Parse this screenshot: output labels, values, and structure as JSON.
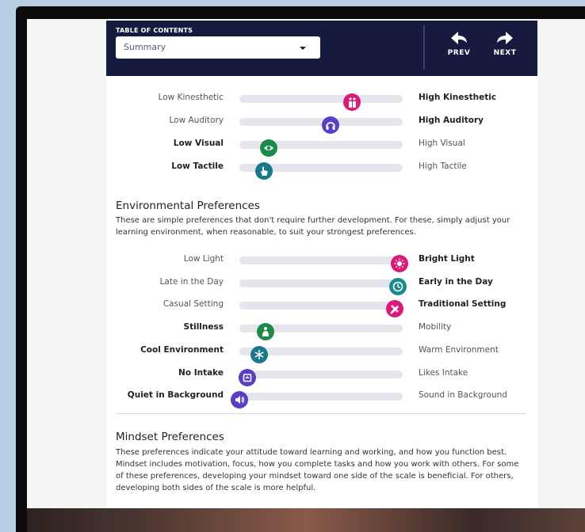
{
  "toc": {
    "label": "TABLE OF CONTENTS",
    "selected": "Summary"
  },
  "nav": {
    "prev_label": "PREV",
    "next_label": "NEXT"
  },
  "learning_rows": [
    {
      "left": "Low Kinesthetic",
      "right": "High Kinesthetic",
      "strong": "right",
      "value": 0.69,
      "icon": "kinesthetic-icon",
      "color": "#d81b78"
    },
    {
      "left": "Low Auditory",
      "right": "High Auditory",
      "strong": "right",
      "value": 0.56,
      "icon": "headphones-icon",
      "color": "#5a3fc4"
    },
    {
      "left": "Low Visual",
      "right": "High Visual",
      "strong": "left",
      "value": 0.18,
      "icon": "eye-icon",
      "color": "#1e8a4a"
    },
    {
      "left": "Low Tactile",
      "right": "High Tactile",
      "strong": "left",
      "value": 0.15,
      "icon": "hand-icon",
      "color": "#1a7a8a"
    }
  ],
  "environmental": {
    "title": "Environmental Preferences",
    "description": "These are simple preferences that don't require further development. For these, simply adjust your learning environment, when reasonable, to suit your strongest preferences.",
    "rows": [
      {
        "left": "Low Light",
        "right": "Bright Light",
        "strong": "right",
        "value": 0.98,
        "icon": "sun-icon",
        "color": "#d81b78"
      },
      {
        "left": "Late in the Day",
        "right": "Early in the Day",
        "strong": "right",
        "value": 0.97,
        "icon": "clock-icon",
        "color": "#1a8a8a"
      },
      {
        "left": "Casual Setting",
        "right": "Traditional Setting",
        "strong": "right",
        "value": 0.95,
        "icon": "pencil-ruler-icon",
        "color": "#d81b78"
      },
      {
        "left": "Stillness",
        "right": "Mobility",
        "strong": "left",
        "value": 0.16,
        "icon": "person-icon",
        "color": "#1e8a4a"
      },
      {
        "left": "Cool Environment",
        "right": "Warm Environment",
        "strong": "left",
        "value": 0.12,
        "icon": "snowflake-icon",
        "color": "#1a7a8a"
      },
      {
        "left": "No Intake",
        "right": "Likes Intake",
        "strong": "left",
        "value": 0.05,
        "icon": "cup-icon",
        "color": "#5a3fc4"
      },
      {
        "left": "Quiet in Background",
        "right": "Sound in Background",
        "strong": "left",
        "value": 0.0,
        "icon": "speaker-icon",
        "color": "#5a3fc4"
      }
    ]
  },
  "mindset": {
    "title": "Mindset Preferences",
    "description": "These preferences indicate your attitude toward learning and working, and how you function best. Mindset includes motivation, focus, how you complete tasks and how you work with others. For some of these preferences, developing your mindset toward one side of the scale is beneficial. For others, developing both sides of the scale is more helpful."
  }
}
